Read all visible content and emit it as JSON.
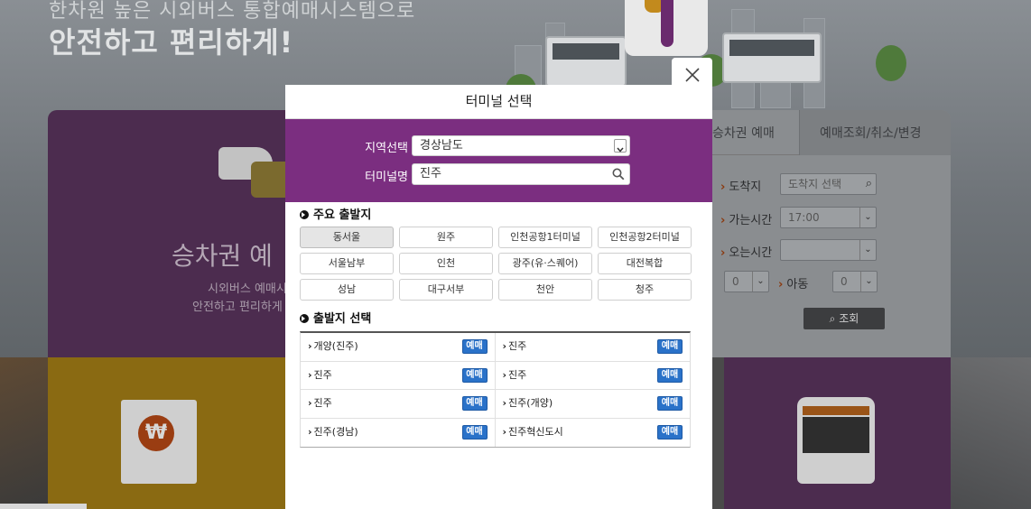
{
  "background": {
    "slogan_line1": "한차원 높은 시외버스 통합예매시스템으로",
    "slogan_line2": "안전하고 편리하게!",
    "ticket_panel_title": "승차권 예",
    "ticket_panel_sub1": "시외버스 예매시",
    "ticket_panel_sub2": "안전하고 편리하게",
    "tabs": [
      "승차권 예매",
      "예매조회/취소/변경"
    ],
    "form": {
      "arrival_label": "도착지",
      "arrival_placeholder": "도착지 선택",
      "departure_date_label": "가는시간",
      "departure_time": "17:00",
      "return_label": "오는시간",
      "adult_count": "0",
      "child_label": "아동",
      "child_count": "0",
      "search_button": "조회"
    },
    "won_symbol": "₩"
  },
  "modal": {
    "title": "터미널 선택",
    "region_label": "지역선택",
    "region_value": "경상남도",
    "terminal_label": "터미널명",
    "terminal_value": "진주",
    "major_section_title": "주요 출발지",
    "major_terminals": [
      "동서울",
      "원주",
      "인천공항1터미널",
      "인천공항2터미널",
      "서울남부",
      "인천",
      "광주(유·스퀘어)",
      "대전복합",
      "성남",
      "대구서부",
      "천안",
      "청주"
    ],
    "departure_section_title": "출발지 선택",
    "reserve_label": "예매",
    "departures": [
      [
        "개양(진주)",
        "진주"
      ],
      [
        "진주",
        "진주"
      ],
      [
        "진주",
        "진주(개양)"
      ],
      [
        "진주(경남)",
        "진주혁신도시"
      ]
    ]
  },
  "colors": {
    "accent_purple": "#7b2e80",
    "reserve_blue": "#2a72c9"
  }
}
